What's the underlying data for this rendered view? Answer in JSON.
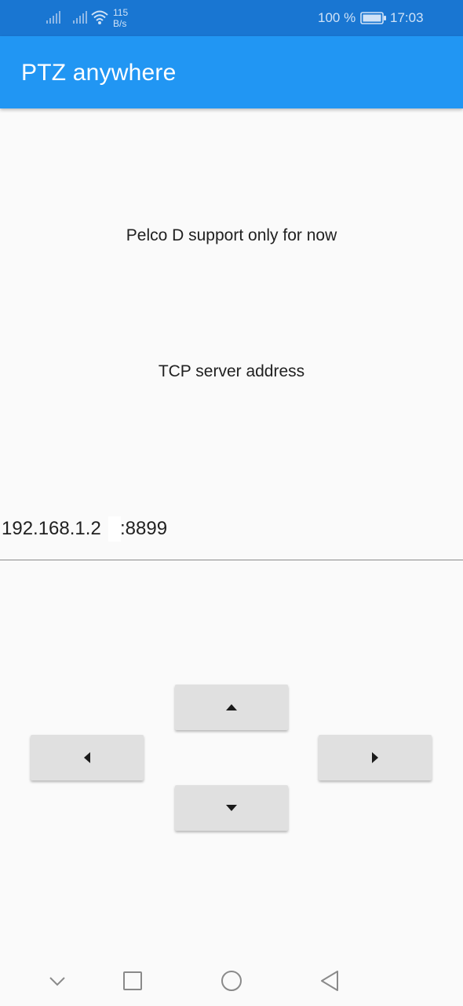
{
  "status_bar": {
    "net_speed_value": "115",
    "net_speed_unit": "B/s",
    "battery": "100 %",
    "time": "17:03",
    "icons": [
      "signal-icon",
      "signal-icon",
      "wifi-icon",
      "battery-icon"
    ]
  },
  "app_bar": {
    "title": "PTZ anywhere",
    "color": "#2196f3",
    "status_color": "#1976d2"
  },
  "main": {
    "support_note": "Pelco D support only for now",
    "tcp_label": "TCP server address",
    "ip_address": "192.168.1.2",
    "port": ":8899"
  },
  "controls": {
    "up_icon": "arrow-up-icon",
    "down_icon": "arrow-down-icon",
    "left_icon": "arrow-left-icon",
    "right_icon": "arrow-right-icon"
  },
  "nav_bar": {
    "icons": [
      "chevron-down-icon",
      "recents-icon",
      "home-icon",
      "back-icon"
    ]
  }
}
